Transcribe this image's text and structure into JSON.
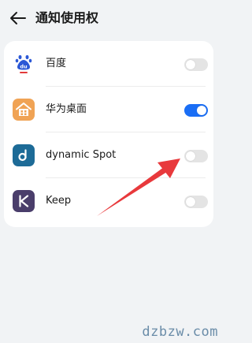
{
  "header": {
    "title": "通知使用权",
    "back_icon": "arrow-left-icon"
  },
  "apps": [
    {
      "name": "百度",
      "icon": "baidu-paw-icon",
      "enabled": false
    },
    {
      "name": "华为桌面",
      "icon": "house-icon",
      "enabled": true
    },
    {
      "name": "dynamic Spot",
      "icon": "dynamic-spot-d-icon",
      "enabled": false
    },
    {
      "name": "Keep",
      "icon": "keep-k-icon",
      "enabled": false
    }
  ],
  "annotation": {
    "arrow_color": "#e8393c",
    "target": "dynamic Spot toggle"
  },
  "watermark": "dzbzw.com",
  "colors": {
    "toggle_on": "#1a6ef5",
    "toggle_off": "#e4e4e4",
    "background": "#f1f3f5"
  }
}
